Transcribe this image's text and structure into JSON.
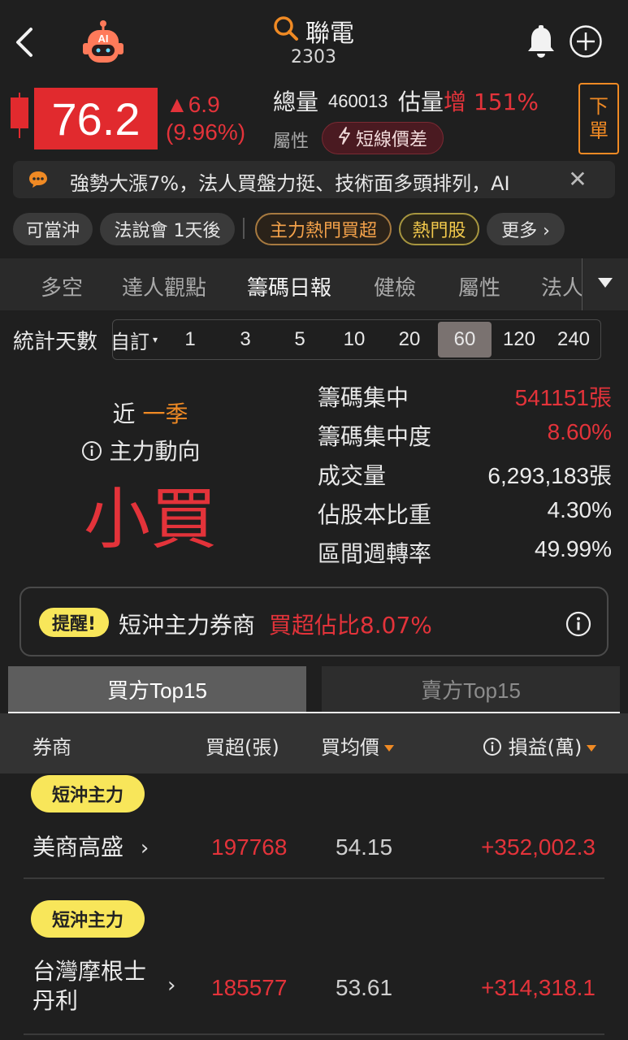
{
  "header": {
    "stock_name": "聯電",
    "stock_code": "2303",
    "ai_label": "AI"
  },
  "quote": {
    "price": "76.2",
    "change": "▲6.9",
    "change_pct": "(9.96%)",
    "volume_label": "總量",
    "volume": "460013",
    "estimate_label": "估量",
    "estimate_value": "增 151%",
    "attr_label": "屬性",
    "attr_badge": "短線價差",
    "order_button": [
      "下",
      "單"
    ]
  },
  "news": {
    "text": "強勢大漲7%，法人買盤力挺、技術面多頭排列，AI",
    "close": "✕"
  },
  "tags": [
    {
      "label": "可當沖"
    },
    {
      "label": "法說會 1天後"
    },
    {
      "label": "主力熱門買超"
    },
    {
      "label": "熱門股"
    },
    {
      "label": "更多 ›"
    }
  ],
  "tabs": [
    {
      "label": "多空"
    },
    {
      "label": "達人觀點"
    },
    {
      "label": "籌碼日報"
    },
    {
      "label": "健檢"
    },
    {
      "label": "屬性"
    },
    {
      "label": "法人"
    }
  ],
  "days": {
    "label": "統計天數",
    "custom": "自訂",
    "options": [
      "1",
      "3",
      "5",
      "10",
      "20",
      "60",
      "120",
      "240"
    ],
    "selected": "60"
  },
  "main_force": {
    "period_prefix": "近",
    "period": "一季",
    "direction_label": "主力動向",
    "direction_value": "小買"
  },
  "stats": [
    {
      "label": "籌碼集中",
      "value": "541151張",
      "color": "#e3333a"
    },
    {
      "label": "籌碼集中度",
      "value": "8.60%",
      "color": "#e3333a"
    },
    {
      "label": "成交量",
      "value": "6,293,183張",
      "color": "#ececec"
    },
    {
      "label": "佔股本比重",
      "value": "4.30%",
      "color": "#ececec"
    },
    {
      "label": "區間週轉率",
      "value": "49.99%",
      "color": "#ececec"
    }
  ],
  "reminder": {
    "badge": "提醒!",
    "text": "短沖主力券商",
    "highlight": "買超佔比8.07%"
  },
  "side_tabs": {
    "buy": "買方Top15",
    "sell": "賣方Top15"
  },
  "table": {
    "headers": {
      "broker": "券商",
      "net_buy": "買超(張)",
      "avg_price": "買均價",
      "pnl": "損益(萬)"
    },
    "rows": [
      {
        "badge": "短沖主力",
        "broker": [
          "美商高盛"
        ],
        "net_buy": "197768",
        "avg_price": "54.15",
        "pnl": "+352,002.3"
      },
      {
        "badge": "短沖主力",
        "broker": [
          "台灣摩根士",
          "丹利"
        ],
        "net_buy": "185577",
        "avg_price": "53.61",
        "pnl": "+314,318.1"
      }
    ]
  },
  "colors": {
    "up": "#e3333a",
    "accent": "#f08a24",
    "badge": "#f8e65a",
    "background": "#1f1f1f"
  }
}
